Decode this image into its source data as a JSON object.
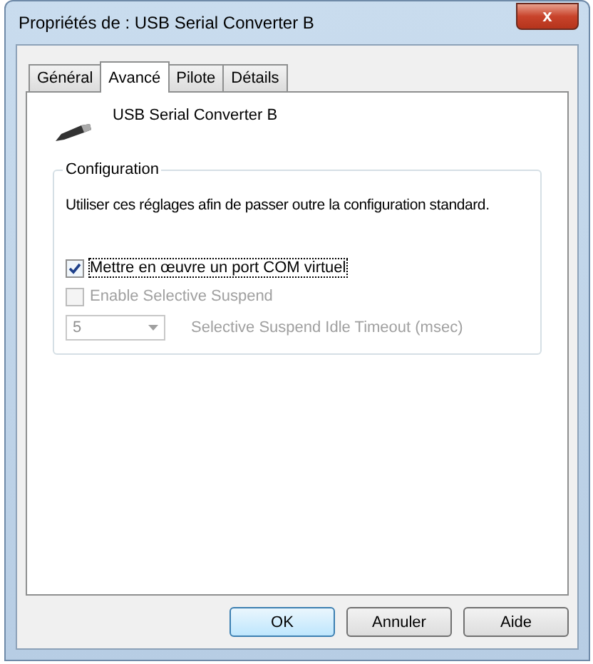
{
  "window": {
    "title": "Propriétés de : USB Serial Converter B",
    "close": "x"
  },
  "tabs": [
    {
      "label": "Général",
      "selected": false
    },
    {
      "label": "Avancé",
      "selected": true
    },
    {
      "label": "Pilote",
      "selected": false
    },
    {
      "label": "Détails",
      "selected": false
    }
  ],
  "device": {
    "name": "USB Serial Converter B"
  },
  "group": {
    "title": "Configuration",
    "description": "Utiliser ces réglages afin de passer outre la configuration standard.",
    "options": [
      {
        "label": "Mettre en œuvre un port COM virtuel",
        "checked": true,
        "disabled": false,
        "focused": true
      },
      {
        "label": "Enable Selective Suspend",
        "checked": false,
        "disabled": true,
        "focused": false
      }
    ],
    "timeout": {
      "value": "5",
      "label": "Selective Suspend Idle Timeout (msec)",
      "disabled": true
    }
  },
  "buttons": [
    {
      "label": "OK",
      "default": true
    },
    {
      "label": "Annuler",
      "default": false
    },
    {
      "label": "Aide",
      "default": false
    }
  ]
}
